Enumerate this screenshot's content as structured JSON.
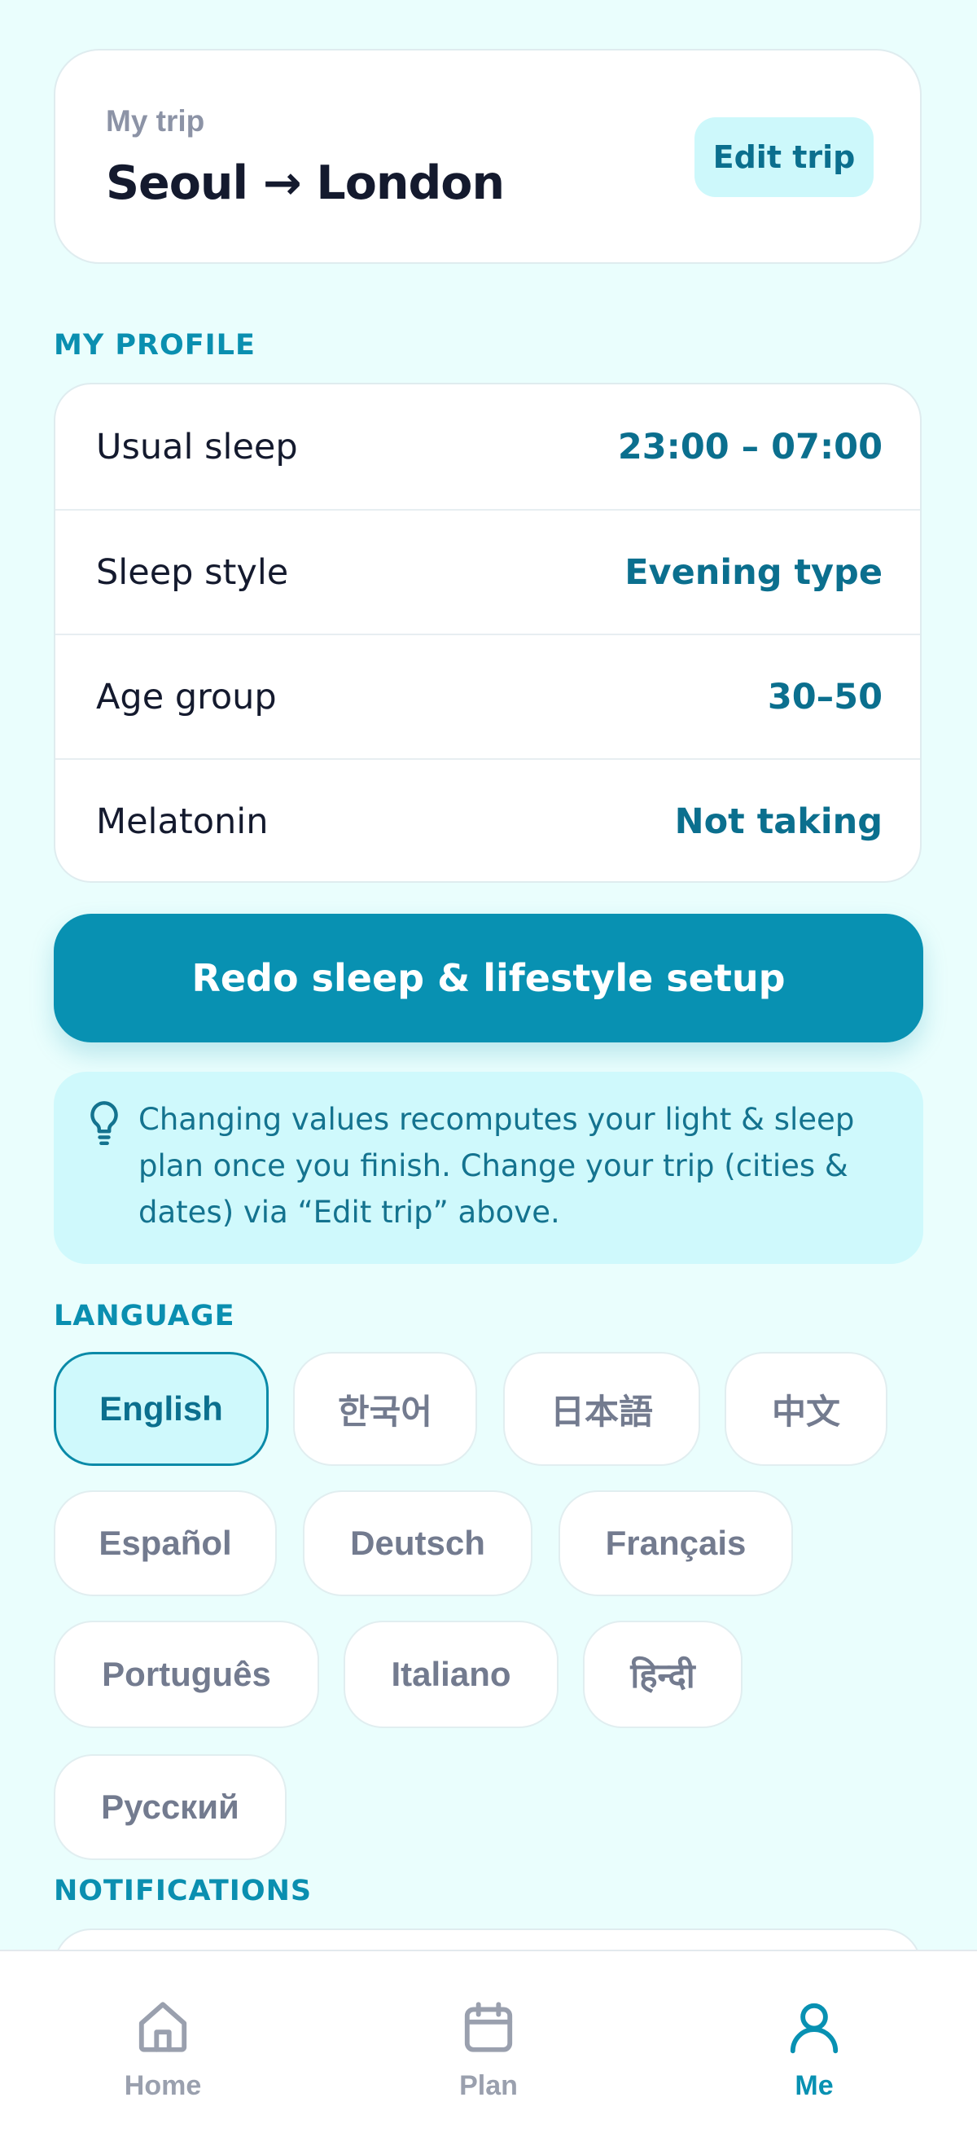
{
  "trip": {
    "label": "My trip",
    "route": "Seoul → London",
    "edit_label": "Edit trip"
  },
  "profile": {
    "section_title": "MY PROFILE",
    "rows": [
      {
        "label": "Usual sleep",
        "value": "23:00 – 07:00"
      },
      {
        "label": "Sleep style",
        "value": "Evening type"
      },
      {
        "label": "Age group",
        "value": "30–50"
      },
      {
        "label": "Melatonin",
        "value": "Not taking"
      }
    ]
  },
  "redo_button": "Redo sleep & lifestyle setup",
  "info": {
    "icon": "lightbulb-icon",
    "text": "Changing values recomputes your light & sleep plan once you finish. Change your trip (cities & dates) via “Edit trip” above."
  },
  "language": {
    "section_title": "LANGUAGE",
    "selected": "English",
    "options": [
      "English",
      "한국어",
      "日本語",
      "中文",
      "Español",
      "Deutsch",
      "Français",
      "Português",
      "Italiano",
      "हिन्दी",
      "Русский"
    ]
  },
  "notifications": {
    "section_title": "NOTIFICATIONS"
  },
  "nav": {
    "items": [
      {
        "label": "Home",
        "icon": "home-icon"
      },
      {
        "label": "Plan",
        "icon": "calendar-icon"
      },
      {
        "label": "Me",
        "icon": "user-icon"
      }
    ],
    "active": "Me"
  },
  "colors": {
    "background": "#eafefd",
    "accent": "#0891b2",
    "value_text": "#0b6f8e",
    "info_bg": "#cff9fc"
  }
}
